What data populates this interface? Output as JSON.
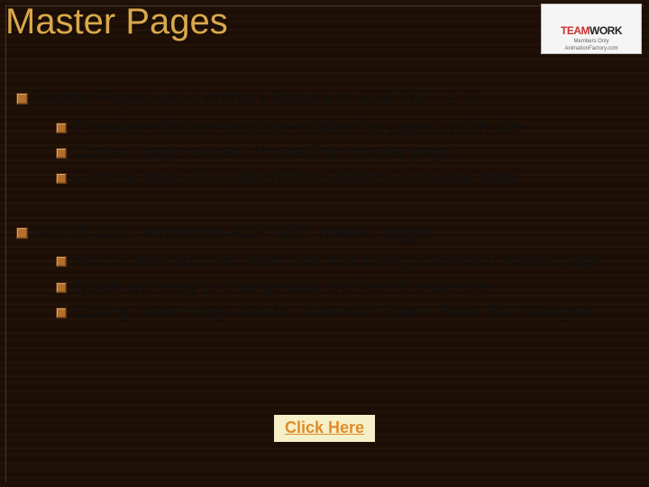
{
  "title": "Master Pages",
  "logo": {
    "word_red": "TEAM",
    "word_black": "WORK",
    "sub1": "Members Only",
    "sub2": "AnimationFactory.com"
  },
  "bullets": [
    {
      "text": "Master Pages are a primary feature in ASP. NET 2. 0",
      "children": [
        "Provides effective template solution for pages within site",
        "Content page reuses chrome from master page",
        "Content page fill in placeholders defined in master page"
      ]
    },
    {
      "text": "MOSS 2007 embraces ASP. NET master pages",
      "children": [
        "MOSS sites such as Team Site built using a standard master page",
        "Quick and easy to change look and feel of entire site",
        "Editing master page can be done with Share. Point Site Designer"
      ]
    }
  ],
  "link_label": "Click Here"
}
